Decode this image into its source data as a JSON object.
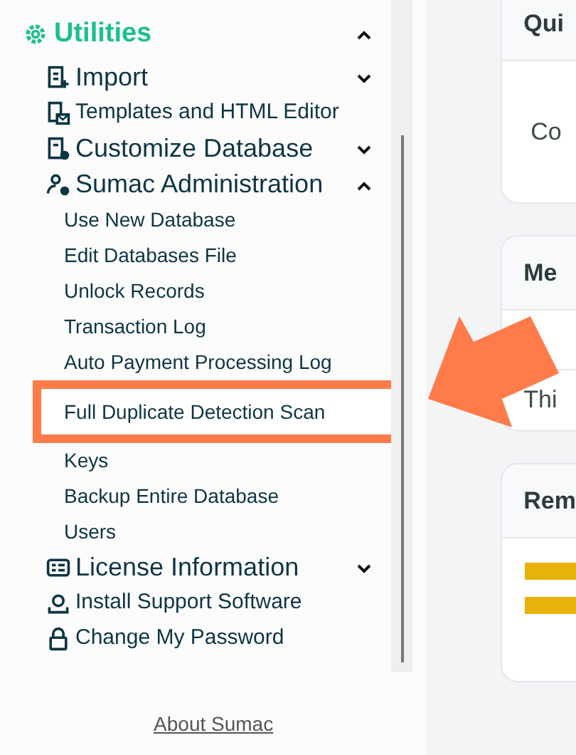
{
  "sidebar": {
    "section": {
      "label": "Utilities",
      "expanded": true
    },
    "items": [
      {
        "label": "Import",
        "kind": "group",
        "expanded": false
      },
      {
        "label": "Templates and HTML Editor",
        "kind": "link"
      },
      {
        "label": "Customize Database",
        "kind": "group",
        "expanded": false
      },
      {
        "label": "Sumac Administration",
        "kind": "group",
        "expanded": true,
        "children": [
          {
            "label": "Use New Database",
            "highlighted": false
          },
          {
            "label": "Edit Databases File",
            "highlighted": false
          },
          {
            "label": "Unlock Records",
            "highlighted": false
          },
          {
            "label": "Transaction Log",
            "highlighted": false
          },
          {
            "label": "Auto Payment Processing Log",
            "highlighted": false
          },
          {
            "label": "Full Duplicate Detection Scan",
            "highlighted": true
          },
          {
            "label": "Keys",
            "highlighted": false
          },
          {
            "label": "Backup Entire Database",
            "highlighted": false
          },
          {
            "label": "Users",
            "highlighted": false
          }
        ]
      },
      {
        "label": "License Information",
        "kind": "group",
        "expanded": false
      },
      {
        "label": "Install Support Software",
        "kind": "link"
      },
      {
        "label": "Change My Password",
        "kind": "link"
      }
    ],
    "footer_link": "About Sumac"
  },
  "cards": [
    {
      "title": "Qui",
      "kind": "text",
      "rows": [
        "Co"
      ]
    },
    {
      "title": "Me",
      "kind": "list",
      "rows": [
        "Thi"
      ]
    },
    {
      "title": "Rem",
      "kind": "bars"
    }
  ]
}
